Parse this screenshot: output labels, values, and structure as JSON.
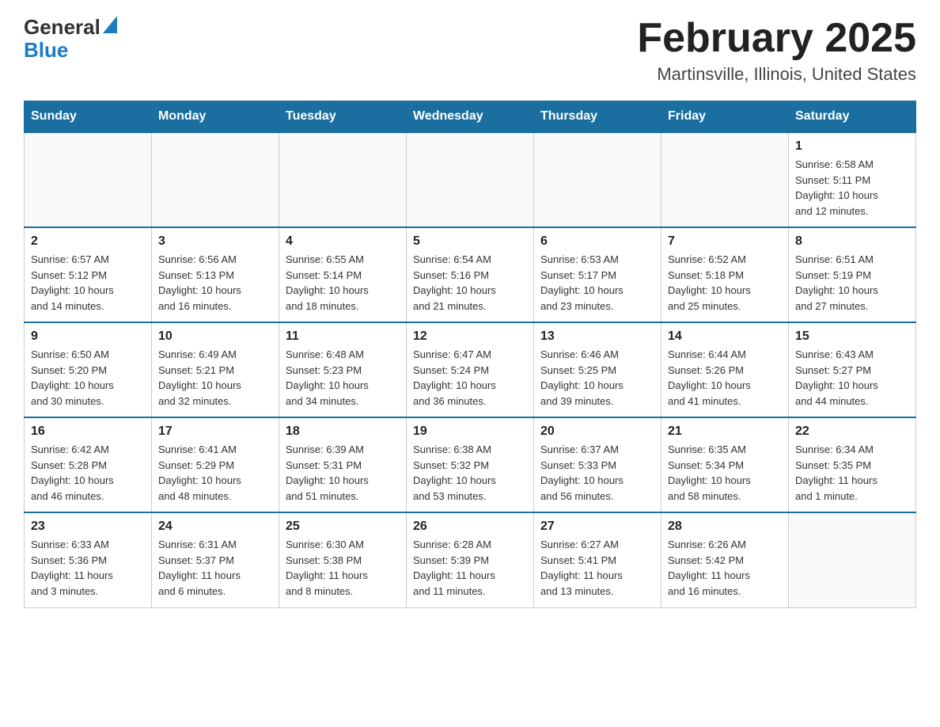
{
  "logo": {
    "general": "General",
    "blue": "Blue"
  },
  "header": {
    "month": "February 2025",
    "location": "Martinsville, Illinois, United States"
  },
  "days_of_week": [
    "Sunday",
    "Monday",
    "Tuesday",
    "Wednesday",
    "Thursday",
    "Friday",
    "Saturday"
  ],
  "weeks": [
    {
      "days": [
        {
          "num": "",
          "info": ""
        },
        {
          "num": "",
          "info": ""
        },
        {
          "num": "",
          "info": ""
        },
        {
          "num": "",
          "info": ""
        },
        {
          "num": "",
          "info": ""
        },
        {
          "num": "",
          "info": ""
        },
        {
          "num": "1",
          "info": "Sunrise: 6:58 AM\nSunset: 5:11 PM\nDaylight: 10 hours\nand 12 minutes."
        }
      ]
    },
    {
      "days": [
        {
          "num": "2",
          "info": "Sunrise: 6:57 AM\nSunset: 5:12 PM\nDaylight: 10 hours\nand 14 minutes."
        },
        {
          "num": "3",
          "info": "Sunrise: 6:56 AM\nSunset: 5:13 PM\nDaylight: 10 hours\nand 16 minutes."
        },
        {
          "num": "4",
          "info": "Sunrise: 6:55 AM\nSunset: 5:14 PM\nDaylight: 10 hours\nand 18 minutes."
        },
        {
          "num": "5",
          "info": "Sunrise: 6:54 AM\nSunset: 5:16 PM\nDaylight: 10 hours\nand 21 minutes."
        },
        {
          "num": "6",
          "info": "Sunrise: 6:53 AM\nSunset: 5:17 PM\nDaylight: 10 hours\nand 23 minutes."
        },
        {
          "num": "7",
          "info": "Sunrise: 6:52 AM\nSunset: 5:18 PM\nDaylight: 10 hours\nand 25 minutes."
        },
        {
          "num": "8",
          "info": "Sunrise: 6:51 AM\nSunset: 5:19 PM\nDaylight: 10 hours\nand 27 minutes."
        }
      ]
    },
    {
      "days": [
        {
          "num": "9",
          "info": "Sunrise: 6:50 AM\nSunset: 5:20 PM\nDaylight: 10 hours\nand 30 minutes."
        },
        {
          "num": "10",
          "info": "Sunrise: 6:49 AM\nSunset: 5:21 PM\nDaylight: 10 hours\nand 32 minutes."
        },
        {
          "num": "11",
          "info": "Sunrise: 6:48 AM\nSunset: 5:23 PM\nDaylight: 10 hours\nand 34 minutes."
        },
        {
          "num": "12",
          "info": "Sunrise: 6:47 AM\nSunset: 5:24 PM\nDaylight: 10 hours\nand 36 minutes."
        },
        {
          "num": "13",
          "info": "Sunrise: 6:46 AM\nSunset: 5:25 PM\nDaylight: 10 hours\nand 39 minutes."
        },
        {
          "num": "14",
          "info": "Sunrise: 6:44 AM\nSunset: 5:26 PM\nDaylight: 10 hours\nand 41 minutes."
        },
        {
          "num": "15",
          "info": "Sunrise: 6:43 AM\nSunset: 5:27 PM\nDaylight: 10 hours\nand 44 minutes."
        }
      ]
    },
    {
      "days": [
        {
          "num": "16",
          "info": "Sunrise: 6:42 AM\nSunset: 5:28 PM\nDaylight: 10 hours\nand 46 minutes."
        },
        {
          "num": "17",
          "info": "Sunrise: 6:41 AM\nSunset: 5:29 PM\nDaylight: 10 hours\nand 48 minutes."
        },
        {
          "num": "18",
          "info": "Sunrise: 6:39 AM\nSunset: 5:31 PM\nDaylight: 10 hours\nand 51 minutes."
        },
        {
          "num": "19",
          "info": "Sunrise: 6:38 AM\nSunset: 5:32 PM\nDaylight: 10 hours\nand 53 minutes."
        },
        {
          "num": "20",
          "info": "Sunrise: 6:37 AM\nSunset: 5:33 PM\nDaylight: 10 hours\nand 56 minutes."
        },
        {
          "num": "21",
          "info": "Sunrise: 6:35 AM\nSunset: 5:34 PM\nDaylight: 10 hours\nand 58 minutes."
        },
        {
          "num": "22",
          "info": "Sunrise: 6:34 AM\nSunset: 5:35 PM\nDaylight: 11 hours\nand 1 minute."
        }
      ]
    },
    {
      "days": [
        {
          "num": "23",
          "info": "Sunrise: 6:33 AM\nSunset: 5:36 PM\nDaylight: 11 hours\nand 3 minutes."
        },
        {
          "num": "24",
          "info": "Sunrise: 6:31 AM\nSunset: 5:37 PM\nDaylight: 11 hours\nand 6 minutes."
        },
        {
          "num": "25",
          "info": "Sunrise: 6:30 AM\nSunset: 5:38 PM\nDaylight: 11 hours\nand 8 minutes."
        },
        {
          "num": "26",
          "info": "Sunrise: 6:28 AM\nSunset: 5:39 PM\nDaylight: 11 hours\nand 11 minutes."
        },
        {
          "num": "27",
          "info": "Sunrise: 6:27 AM\nSunset: 5:41 PM\nDaylight: 11 hours\nand 13 minutes."
        },
        {
          "num": "28",
          "info": "Sunrise: 6:26 AM\nSunset: 5:42 PM\nDaylight: 11 hours\nand 16 minutes."
        },
        {
          "num": "",
          "info": ""
        }
      ]
    }
  ]
}
